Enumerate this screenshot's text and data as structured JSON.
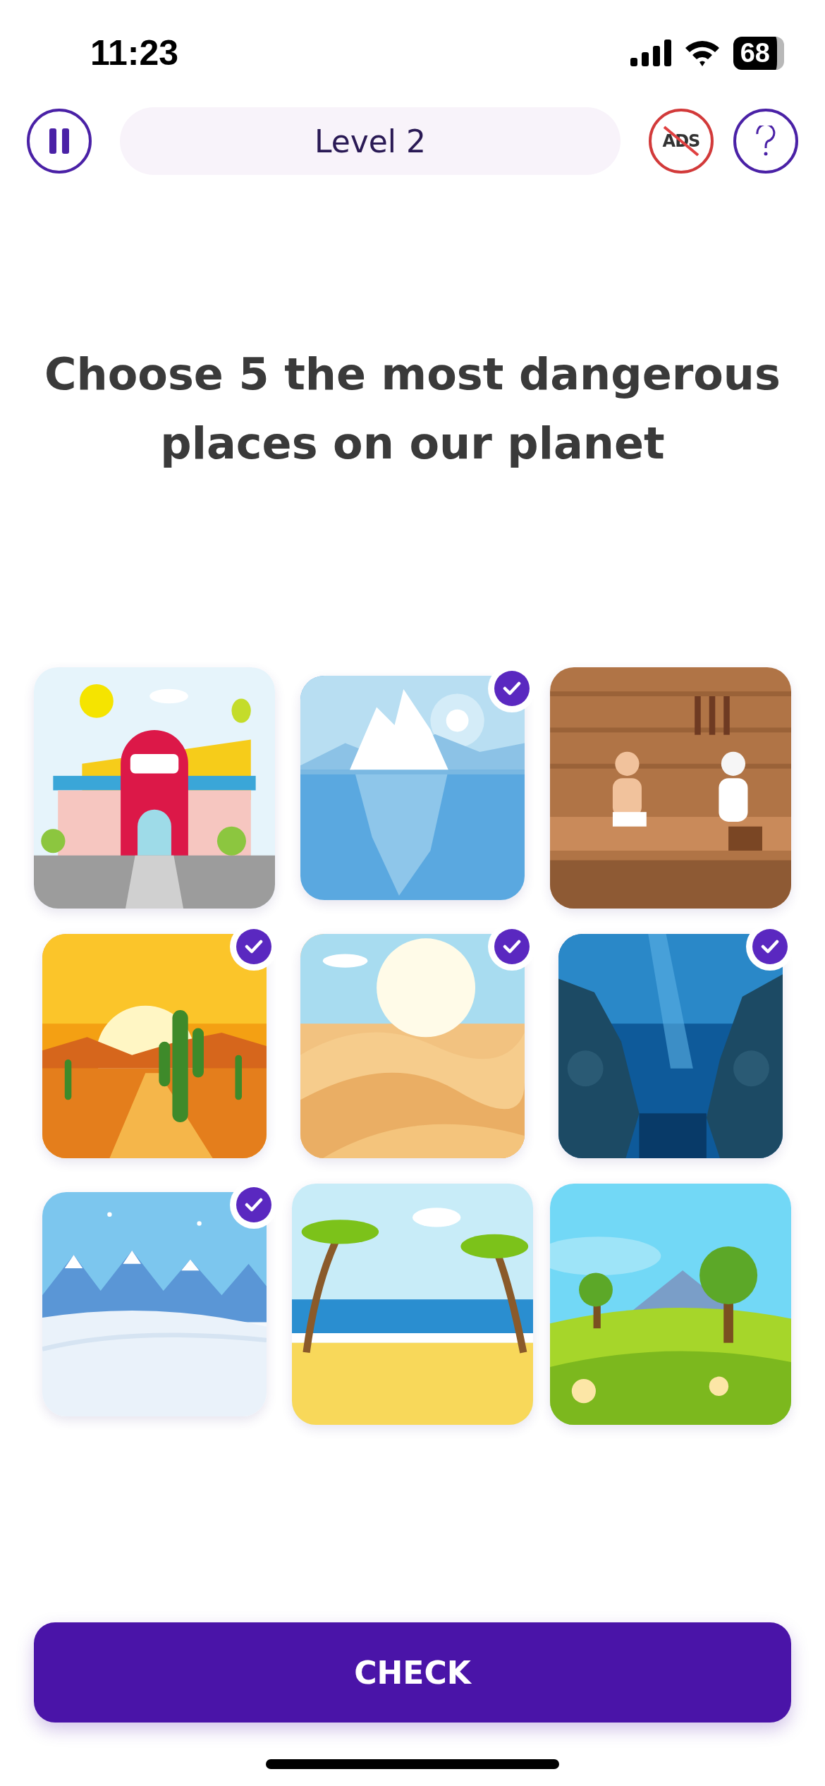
{
  "status_bar": {
    "time": "11:23",
    "battery": "68"
  },
  "header": {
    "level_label": "Level 2",
    "ads_label": "ADS"
  },
  "question": "Choose 5 the most dangerous places on our planet",
  "tiles": [
    {
      "kind": "picture",
      "selected": false
    },
    {
      "kind": "picture",
      "selected": true
    },
    {
      "kind": "picture",
      "selected": false
    },
    {
      "kind": "picture",
      "selected": true
    },
    {
      "kind": "picture",
      "selected": true
    },
    {
      "kind": "picture",
      "selected": true
    },
    {
      "kind": "picture",
      "selected": true
    },
    {
      "kind": "picture",
      "selected": false
    },
    {
      "kind": "picture",
      "selected": false
    }
  ],
  "check_button": "CHECK"
}
